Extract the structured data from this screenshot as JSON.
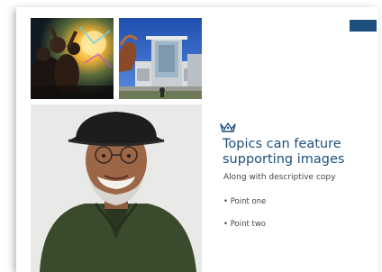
{
  "slide": {
    "heading_lines": [
      "Topics can feature",
      "supporting images"
    ],
    "subcopy": "Along with descriptive copy",
    "bullets": [
      "• Point one",
      "• Point two"
    ]
  },
  "colors": {
    "accent": "#1d4f7c",
    "text_body": "#444444",
    "background": "#ffffff"
  },
  "icons": {
    "crown": "crown-icon"
  },
  "images": {
    "top_left": "concert-crowd-photo",
    "top_right": "campus-building-photo",
    "main": "smiling-man-in-cap-portrait"
  }
}
